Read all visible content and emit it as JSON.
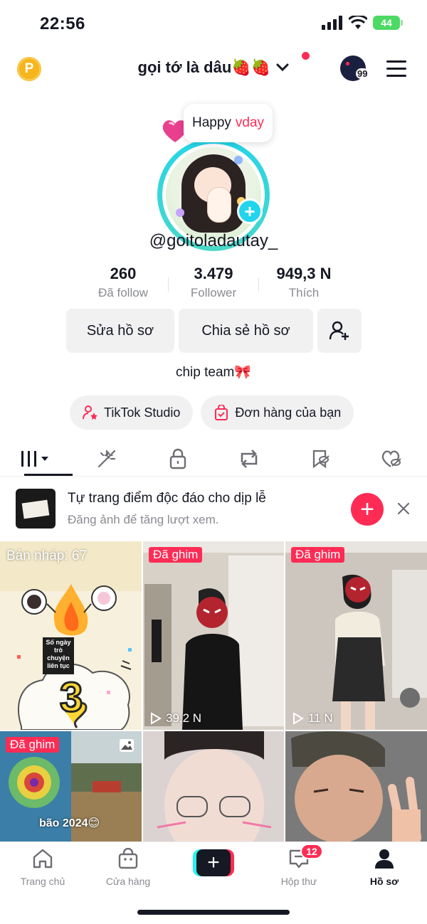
{
  "status_bar": {
    "time": "22:56",
    "battery": "44"
  },
  "header": {
    "coin_label": "P",
    "username": "gọi tớ là dâu🍓🍓",
    "account_badge": "99"
  },
  "note": {
    "text": "Happy",
    "highlight": "vday"
  },
  "profile": {
    "handle": "@goitoladautay_",
    "stats": [
      {
        "value": "260",
        "label": "Đã follow"
      },
      {
        "value": "3.479",
        "label": "Follower"
      },
      {
        "value": "949,3 N",
        "label": "Thích"
      }
    ],
    "edit_button": "Sửa hồ sơ",
    "share_button": "Chia sẻ hồ sơ",
    "bio": "chip team🎀",
    "studio_button": "TikTok Studio",
    "orders_button": "Đơn hàng của bạn"
  },
  "tabs": [
    "videos-grid",
    "reposts-sparkle",
    "private-lock",
    "repost",
    "favorites-hidden",
    "liked-hidden"
  ],
  "promo": {
    "title": "Tự trang điểm độc đáo cho dịp lễ",
    "subtitle": "Đăng ảnh để tăng lượt xem."
  },
  "grid": [
    {
      "label": "Bản nháp: 67",
      "type": "draft",
      "overlay_text": "Số ngày trò chuyện liên tục",
      "number": "3"
    },
    {
      "label": "Đã ghim",
      "views": "39,2 N"
    },
    {
      "label": "Đã ghim",
      "views": "11 N"
    },
    {
      "label": "Đã ghim",
      "caption": "bão 2024😊"
    },
    {
      "label": ""
    },
    {
      "label": ""
    }
  ],
  "bottom_nav": {
    "home": "Trang chủ",
    "shop": "Cửa hàng",
    "create": "+",
    "inbox": "Hộp thư",
    "inbox_count": "12",
    "profile": "Hồ sơ"
  },
  "colors": {
    "accent": "#fe2c55",
    "teal": "#20d5ec",
    "text": "#161823",
    "muted": "#8a8b91"
  }
}
